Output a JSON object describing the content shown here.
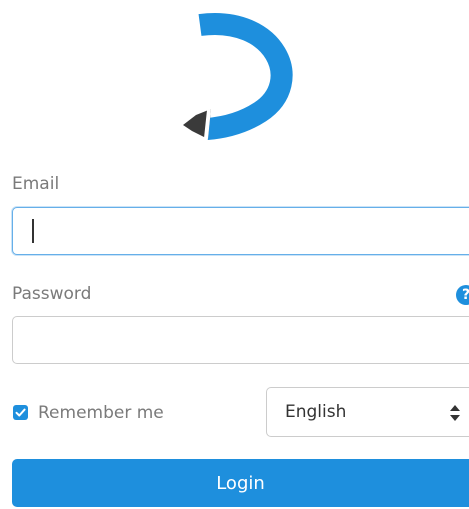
{
  "logo": {
    "icon": "highlighter-hook-logo-icon",
    "accent_color": "#1e8fdd",
    "tip_color": "#3a3a3a"
  },
  "form": {
    "email_label": "Email",
    "email_value": "",
    "password_label": "Password",
    "password_value": "",
    "help_icon_glyph": "?",
    "remember_label": "Remember me",
    "remember_checked": true,
    "language_selected": "English",
    "login_label": "Login"
  },
  "colors": {
    "primary": "#1e8fdd",
    "label": "#7a7a7a",
    "border": "#cccccc",
    "focus_border": "#66afe9"
  }
}
